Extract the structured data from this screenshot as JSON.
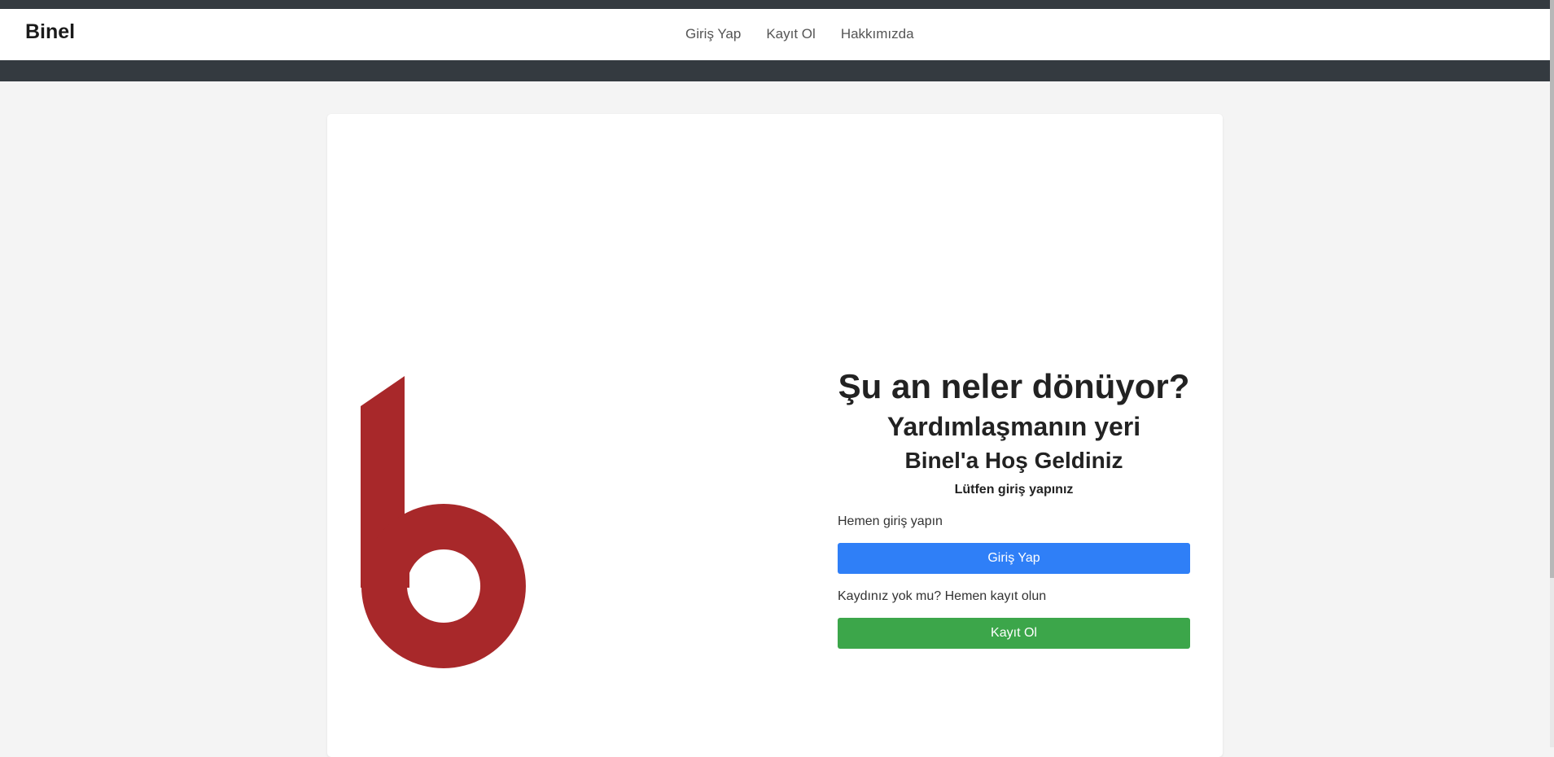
{
  "navbar": {
    "brand": "Binel",
    "links": [
      "Giriş Yap",
      "Kayıt Ol",
      "Hakkımızda"
    ]
  },
  "hero": {
    "headline": "Şu an neler dönüyor?",
    "subheadline": "Yardımlaşmanın yeri",
    "welcome": "Binel'a Hoş Geldiniz",
    "prompt": "Lütfen giriş yapınız"
  },
  "login": {
    "label": "Hemen giriş yapın",
    "button": "Giriş Yap"
  },
  "register": {
    "label": "Kaydınız yok mu? Hemen kayıt olun",
    "button": "Kayıt Ol"
  },
  "colors": {
    "dark_bar": "#343a40",
    "logo_red": "#a8282a",
    "primary": "#2f7ff7",
    "success": "#3ca64a"
  },
  "icons": {
    "logo": "binel-b-logo"
  }
}
